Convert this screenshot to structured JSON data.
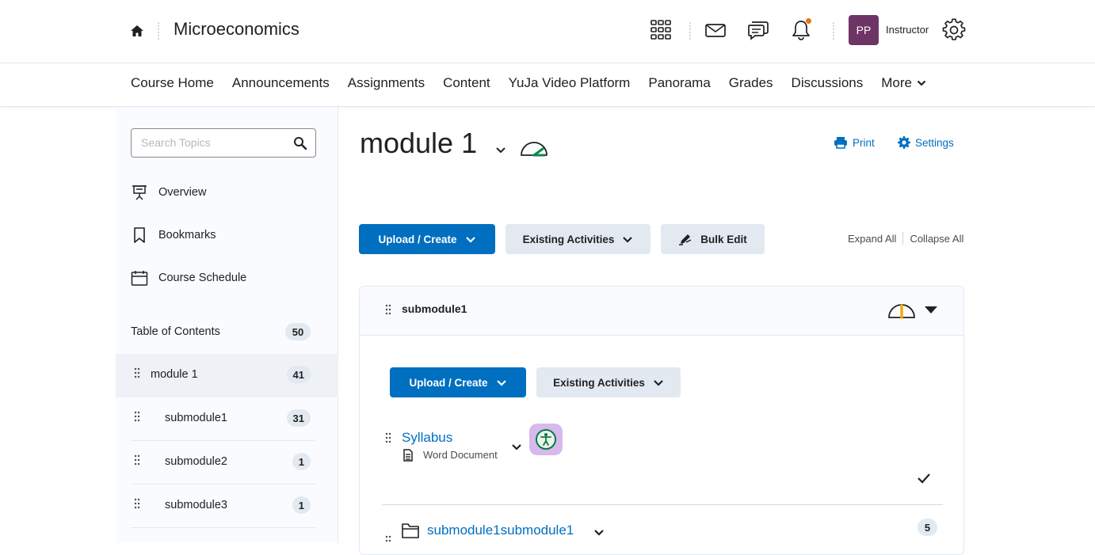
{
  "header": {
    "course_title": "Microeconomics",
    "avatar_initials": "PP",
    "role": "Instructor",
    "notification_dot_color": "#e87511",
    "avatar_color": "#6e3466"
  },
  "navbar": {
    "links": [
      "Course Home",
      "Announcements",
      "Assignments",
      "Content",
      "YuJa Video Platform",
      "Panorama",
      "Grades",
      "Discussions"
    ],
    "more_label": "More"
  },
  "sidebar": {
    "search_placeholder": "Search Topics",
    "overview": "Overview",
    "bookmarks": "Bookmarks",
    "course_schedule": "Course Schedule",
    "toc_label": "Table of Contents",
    "toc_count": "50",
    "items": [
      {
        "label": "module 1",
        "count": "41",
        "active": true
      },
      {
        "label": "submodule1",
        "count": "31"
      },
      {
        "label": "submodule2",
        "count": "1"
      },
      {
        "label": "submodule3",
        "count": "1"
      }
    ]
  },
  "main": {
    "title": "module 1",
    "print_label": "Print",
    "settings_label": "Settings",
    "upload_create_label": "Upload / Create",
    "existing_activities_label": "Existing Activities",
    "bulk_edit_label": "Bulk Edit",
    "expand_all": "Expand All",
    "collapse_all": "Collapse All",
    "accent_color": "#006fbf",
    "panel": {
      "title": "submodule1",
      "upload_create_label": "Upload / Create",
      "existing_activities_label": "Existing Activities",
      "topics": [
        {
          "title": "Syllabus",
          "type": "Word Document",
          "completed": true
        },
        {
          "title": "submodule1submodule1",
          "count": "5"
        }
      ]
    }
  }
}
